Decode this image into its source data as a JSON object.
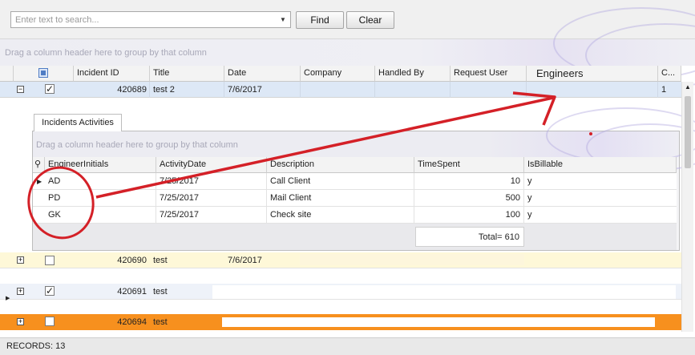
{
  "search": {
    "placeholder": "Enter text to search...",
    "find_label": "Find",
    "clear_label": "Clear"
  },
  "group_panel_text": "Drag a column header here to group by that column",
  "columns": [
    "Incident ID",
    "Title",
    "Date",
    "Company",
    "Handled By",
    "Request User",
    "Engineers",
    "C..."
  ],
  "rows": [
    {
      "id": "420689",
      "title": "test 2",
      "date": "7/6/2017",
      "engineers": "1",
      "checked": true,
      "expanded": true
    },
    {
      "id": "420690",
      "title": "test",
      "date": "7/6/2017",
      "checked": false,
      "expanded": false
    },
    {
      "id": "420691",
      "title": "test",
      "checked": true,
      "expanded": false
    },
    {
      "id": "420694",
      "title": "test",
      "checked": false,
      "expanded": false
    }
  ],
  "detail": {
    "tab_label": "Incidents Activities",
    "group_panel_text": "Drag a column header here to group by that column",
    "columns": [
      "EngineerInitials",
      "ActivityDate",
      "Description",
      "TimeSpent",
      "IsBillable"
    ],
    "rows": [
      {
        "initials": "AD",
        "date": "7/25/2017",
        "description": "Call Client",
        "time": "10",
        "billable": "y"
      },
      {
        "initials": "PD",
        "date": "7/25/2017",
        "description": "Mail Client",
        "time": "500",
        "billable": "y"
      },
      {
        "initials": "GK",
        "date": "7/25/2017",
        "description": "Check site",
        "time": "100",
        "billable": "y"
      }
    ],
    "total": "Total= 610"
  },
  "status": {
    "records": "RECORDS: 13"
  },
  "colors": {
    "selected_row": "#dde8f6",
    "highlight_row": "#fef8d8",
    "orange_row": "#f7901e",
    "annotation": "#d42027"
  },
  "icons": {
    "expand": "plus-icon",
    "collapse": "minus-icon",
    "row_indicator": "triangle-right-icon",
    "dropdown": "chevron-down-icon",
    "search_column": "magnifier-icon"
  }
}
